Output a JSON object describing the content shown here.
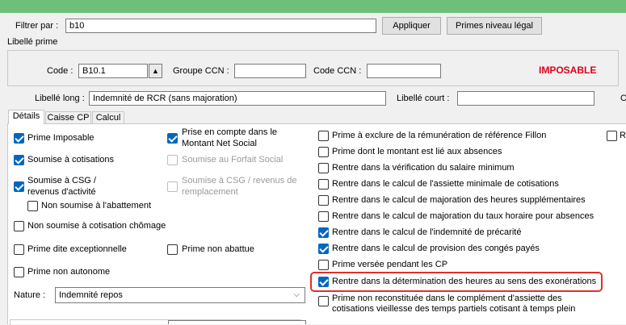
{
  "filter": {
    "label": "Filtrer par :",
    "value": "b10",
    "apply_button": "Appliquer",
    "legal_button": "Primes niveau légal"
  },
  "group_title": "Libellé prime",
  "code": {
    "label": "Code :",
    "value": "B10.1",
    "spin_glyph": "▲"
  },
  "groupe_ccn": {
    "label": "Groupe CCN :",
    "value": ""
  },
  "code_ccn": {
    "label": "Code CCN :",
    "value": ""
  },
  "status": {
    "text": "IMPOSABLE",
    "color": "#e0001a"
  },
  "libelle_long": {
    "label": "Libellé long :",
    "value": "Indemnité de RCR (sans majoration)"
  },
  "libelle_court": {
    "label": "Libellé court :",
    "value": ""
  },
  "edge_label": "C",
  "tabs": [
    {
      "label": "Détails",
      "active": true
    },
    {
      "label": "Caisse CP",
      "active": false
    },
    {
      "label": "Calcul",
      "active": false
    }
  ],
  "left_checks": [
    {
      "label": "Prime Imposable",
      "checked": true
    },
    {
      "label": "Soumise à cotisations",
      "checked": true
    },
    {
      "label": "Soumise à CSG /",
      "label2": "revenus d'activité",
      "checked": true
    },
    {
      "label": "Non soumise à l'abattement",
      "checked": false
    },
    {
      "label": "Non soumise à cotisation chômage",
      "checked": false
    },
    {
      "label": "Prime dite exceptionnelle",
      "checked": false
    },
    {
      "label": "Prime non autonome",
      "checked": false
    }
  ],
  "mid_checks": [
    {
      "label": "Prise en compte dans le",
      "label2": "Montant Net Social",
      "checked": true,
      "disabled": false
    },
    {
      "label": "Soumise au Forfait Social",
      "checked": false,
      "disabled": true
    },
    {
      "label": "Soumise à CSG / revenus de",
      "label2": "remplacement",
      "checked": false,
      "disabled": true
    },
    {
      "label": "Prime non abattue",
      "checked": false,
      "disabled": false
    }
  ],
  "right_checks": [
    {
      "label": "Prime à exclure de la rémunération de référence Fillon",
      "checked": false
    },
    {
      "label": "Prime dont le montant est lié aux absences",
      "checked": false
    },
    {
      "label": "Rentre dans la vérification du salaire minimum",
      "checked": false
    },
    {
      "label": "Rentre dans le calcul de l'assiette minimale de cotisations",
      "checked": false
    },
    {
      "label": "Rentre dans le calcul de majoration des heures supplémentaires",
      "checked": false
    },
    {
      "label": "Rentre dans le calcul de majoration du taux horaire pour absences",
      "checked": false
    },
    {
      "label": "Rentre dans le calcul de l'indemnité de précarité",
      "checked": true
    },
    {
      "label": "Rentre dans le calcul de provision des congés payés",
      "checked": true
    },
    {
      "label": "Prime versée pendant les CP",
      "checked": false
    },
    {
      "label": "Rentre dans la détermination des heures au sens des exonérations",
      "checked": true
    },
    {
      "label": "Prime non reconstituée dans le complément d'assiette des",
      "label2": "cotisations vieillesse des temps partiels cotisant à temps plein",
      "checked": false
    }
  ],
  "edge_check": {
    "label": "Re",
    "checked": false
  },
  "nature": {
    "label": "Nature :",
    "value": "Indemnité repos",
    "arrow": "⌵"
  }
}
